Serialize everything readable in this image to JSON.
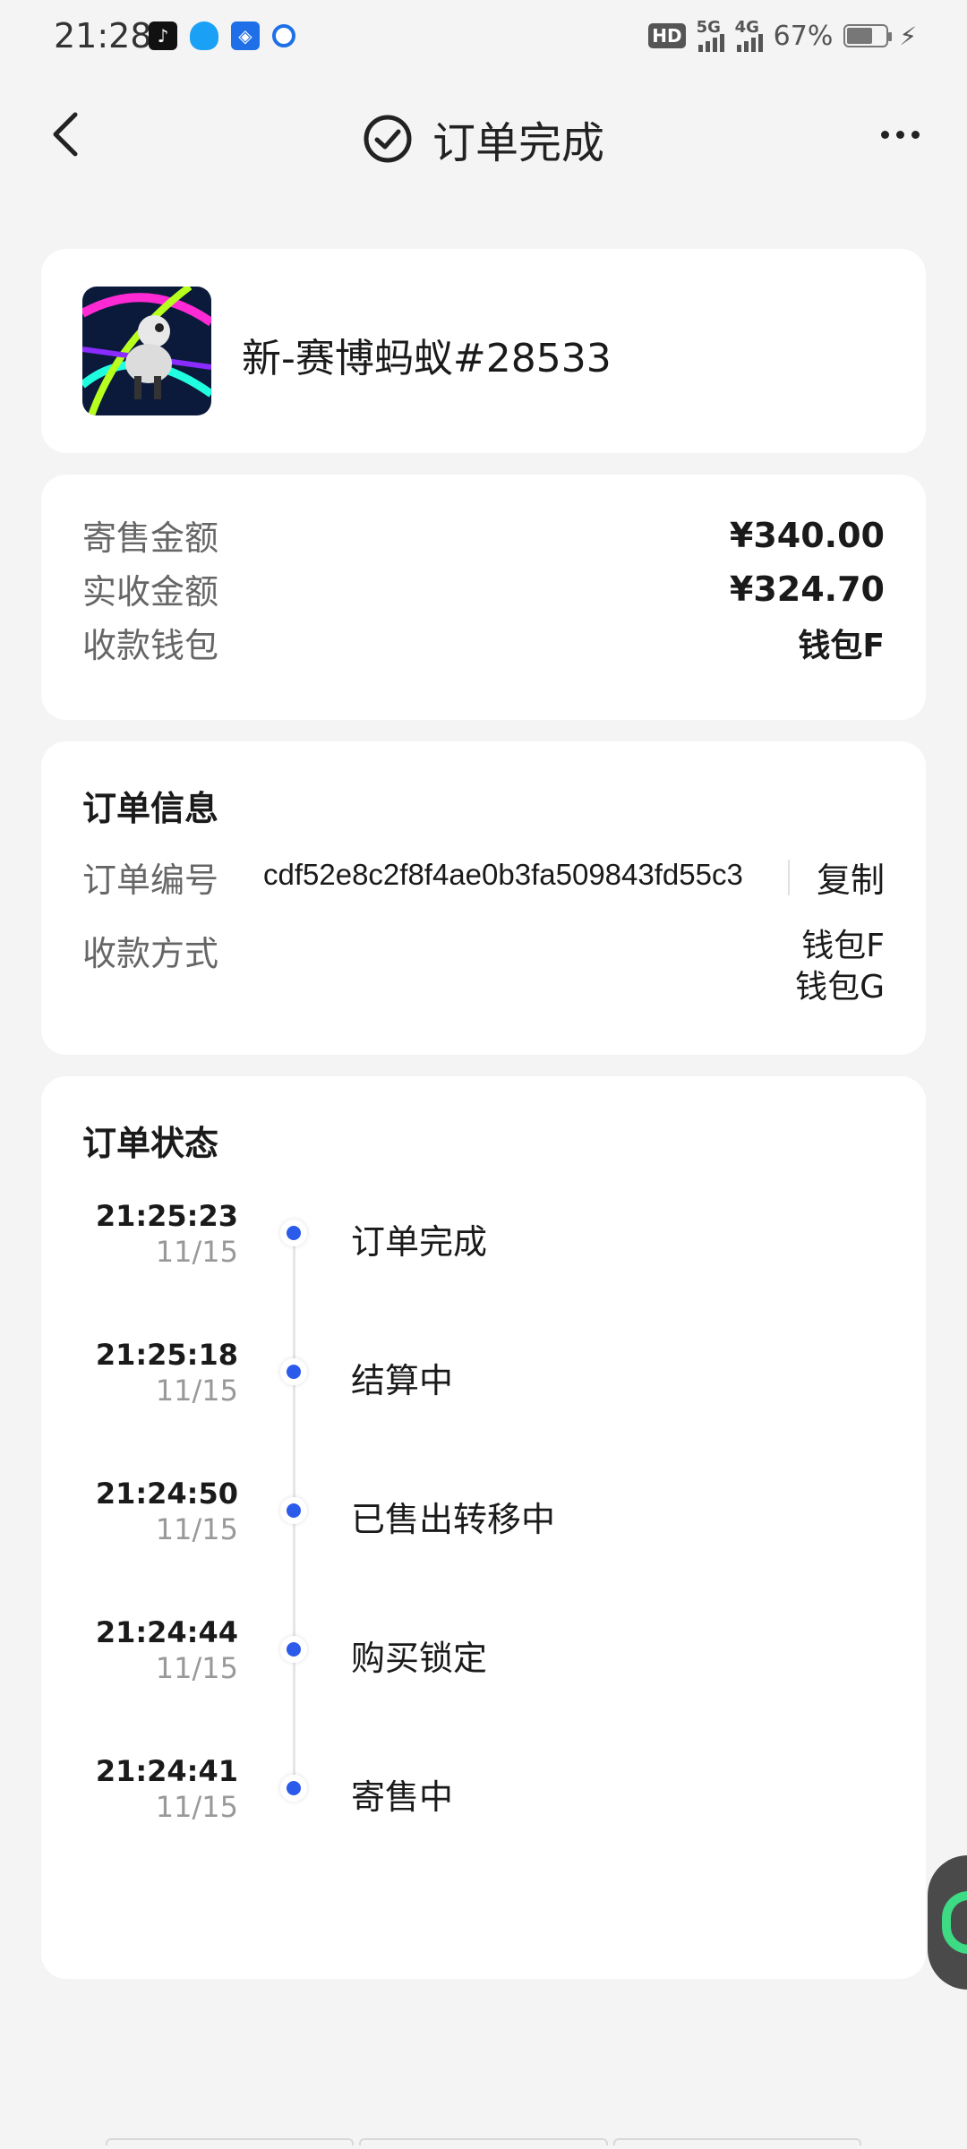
{
  "status_bar": {
    "time": "21:28",
    "apps": [
      "tiktok-icon",
      "qq-icon",
      "app-icon",
      "browser-icon"
    ],
    "hd_label": "HD",
    "net1": "5G",
    "net2": "4G",
    "battery": "67%",
    "battery_level": 0.67
  },
  "header": {
    "title": "订单完成",
    "icons": {
      "back": "chevron-left-icon",
      "title": "check-circle-icon",
      "more": "more-horizontal-icon"
    }
  },
  "product": {
    "name": "新-赛博蚂蚁#28533",
    "thumbnail": "product-thumbnail"
  },
  "amounts": {
    "sale_label": "寄售金额",
    "sale_value": "¥340.00",
    "received_label": "实收金额",
    "received_value": "¥324.70",
    "wallet_label": "收款钱包",
    "wallet_value": "钱包F"
  },
  "order_info": {
    "title": "订单信息",
    "order_no_label": "订单编号",
    "order_no": "cdf52e8c2f8f4ae0b3fa509843fd55c3",
    "copy_label": "复制",
    "pay_method_label": "收款方式",
    "pay_methods": [
      "钱包F",
      "钱包G"
    ]
  },
  "order_status": {
    "title": "订单状态",
    "events": [
      {
        "time": "21:25:23",
        "date": "11/15",
        "label": "订单完成"
      },
      {
        "time": "21:25:18",
        "date": "11/15",
        "label": "结算中"
      },
      {
        "time": "21:24:50",
        "date": "11/15",
        "label": "已售出转移中"
      },
      {
        "time": "21:24:44",
        "date": "11/15",
        "label": "购买锁定"
      },
      {
        "time": "21:24:41",
        "date": "11/15",
        "label": "寄售中"
      }
    ]
  },
  "colors": {
    "accent": "#2a5bea",
    "background": "#f4f4f5",
    "card": "#ffffff",
    "float_widget": "#3ddc84"
  }
}
